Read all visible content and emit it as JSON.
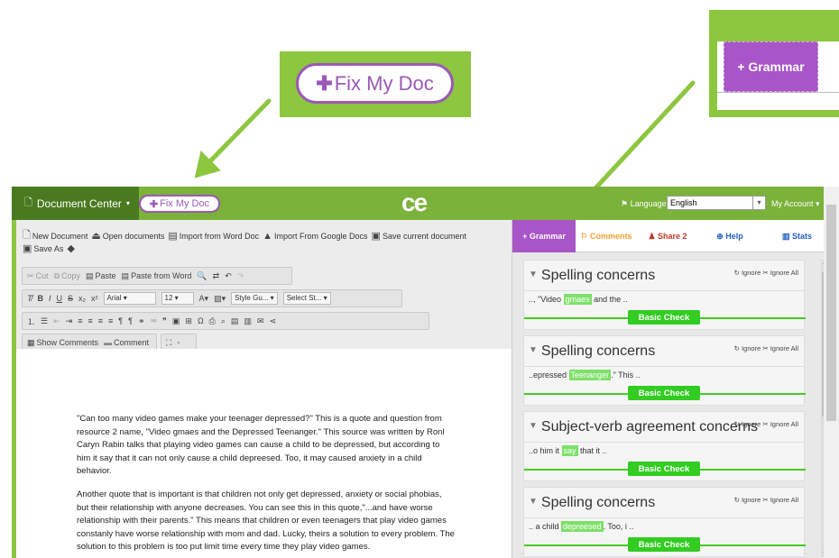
{
  "callouts": {
    "fix_button": "Fix My Doc",
    "grammar_button": "+ Grammar"
  },
  "header": {
    "document_center": "Document Center",
    "fix_button": "Fix My Doc",
    "logo": "ce",
    "language_label": "Language:",
    "language_value": "English",
    "account": "My Account"
  },
  "toolbar": {
    "file_actions": [
      "New Document",
      "Open documents",
      "Import from Word Doc",
      "Import From Google Docs",
      "Save current document"
    ],
    "save_as": "Save As",
    "cut": "Cut",
    "copy": "Copy",
    "paste": "Paste",
    "paste_word": "Paste from Word",
    "font": "Arial",
    "size": "12",
    "style_select": "Style Gu...",
    "select_select": "Select St...",
    "show_comments": "Show Comments",
    "comment": "Comment"
  },
  "editor": {
    "paragraph1": "\"Can too many video games make your teenager depressed?\" This is a quote and question from resource 2 name, \"Video gmaes and the Depressed Teenanger.\" This source was written by Ronl Caryn Rabin talks that playing video games can cause a child to be depressed, but according to him it say that it can not only cause a child depreesed. Too, it may caused anxiety in a child behavior.",
    "paragraph2": "Another quote that is important is that children not only get depressed, anxiety or social phobias, but their relationship with anyone decreases. You can see this in this quote,\"...and have worse relationship with their parents.\" This means that children or even teenagers that play video games constanly have worse relationship with mom and dad. Lucky, theirs a solution to every problem. The solution to this problem is too put limit time every time they play video games."
  },
  "panel": {
    "tabs": [
      {
        "label": "+ Grammar",
        "color": "#ffffff"
      },
      {
        "label": "Comments",
        "color": "#f0a030"
      },
      {
        "label": "Share 2",
        "color": "#c0392b"
      },
      {
        "label": "Help",
        "color": "#2060c0"
      },
      {
        "label": "Stats",
        "color": "#2060c0"
      }
    ],
    "ignore": "Ignore",
    "ignore_all": "Ignore All",
    "badge": "Basic Check",
    "cards": [
      {
        "title": "Spelling concerns",
        "pre": ".., \"Video ",
        "word": "gmaes",
        "post": " and the .."
      },
      {
        "title": "Spelling concerns",
        "pre": "..epressed ",
        "word": "Teenanger",
        "post": ".\" This .."
      },
      {
        "title": "Subject-verb agreement concerns",
        "pre": "..o him it ",
        "word": "say",
        "post": " that it .."
      },
      {
        "title": "Spelling concerns",
        "pre": ".. a child ",
        "word": "depreesed",
        "post": ". Too, i .."
      }
    ]
  },
  "colors": {
    "green": "#8dc63f",
    "dark_green": "#4a7a1f",
    "purple": "#9b59b6",
    "grammar_tab": "#a855c8"
  }
}
